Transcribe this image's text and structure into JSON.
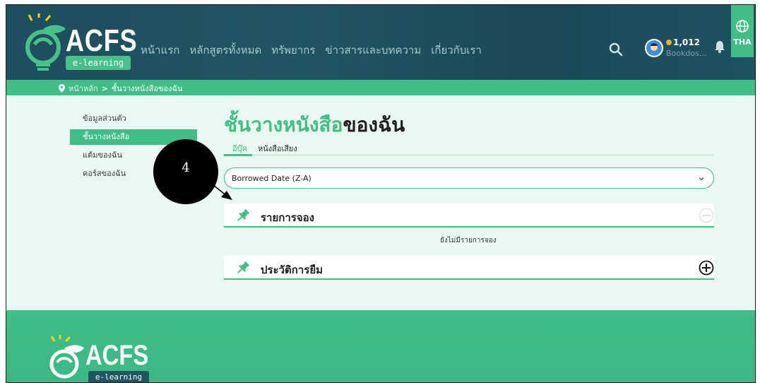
{
  "header": {
    "logo_text": "ACFS",
    "logo_sub": "e-learning",
    "nav": [
      "หน้าแรก",
      "หลักสูตรทั้งหมด",
      "ทรัพยากร",
      "ข่าวสารและบทความ",
      "เกี่ยวกับเรา"
    ],
    "coins": "1,012",
    "user_name": "Bookdos...",
    "language": "THA",
    "icons": [
      "search-icon",
      "avatar",
      "bell-icon",
      "globe-icon"
    ]
  },
  "breadcrumb": {
    "home": "หน้าหลัก",
    "separator": ">",
    "current": "ชั้นวางหนังสือของฉัน"
  },
  "sidebar": {
    "items": [
      {
        "label": "ข้อมูลส่วนตัว",
        "active": false
      },
      {
        "label": "ชั้นวางหนังสือ",
        "active": true
      },
      {
        "label": "แต้มของฉัน",
        "active": false
      },
      {
        "label": "คอร์สของฉัน",
        "active": false
      }
    ]
  },
  "main": {
    "title_part1": "ชั้นวางหนังสือ",
    "title_part2": "ของฉัน",
    "tabs": [
      {
        "label": "อีบุ๊ค",
        "active": true
      },
      {
        "label": "หนังสือเสียง",
        "active": false
      }
    ],
    "sort_value": "Borrowed Date (Z-A)",
    "panels": [
      {
        "title": "รายการจอง",
        "expanded": true,
        "empty_message": "ยังไม่มีรายการจอง"
      },
      {
        "title": "ประวัติการยืม",
        "expanded": false
      }
    ]
  },
  "annotation": {
    "number": "4"
  },
  "footer": {
    "logo_text": "ACFS",
    "logo_sub": "e-learning"
  },
  "colors": {
    "header_bg": "#1d4f5c",
    "accent": "#3fbe86",
    "page_bg": "#e9f8f2",
    "coin": "#f2b01e"
  }
}
